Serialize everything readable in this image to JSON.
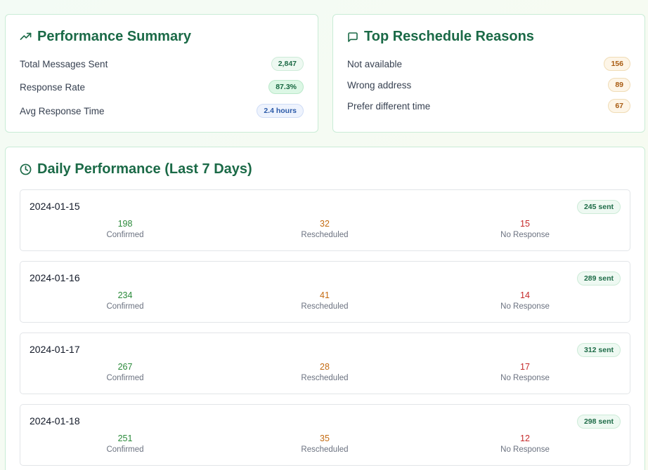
{
  "performance_summary": {
    "title": "Performance Summary",
    "icon": "trending-up-icon",
    "rows": [
      {
        "label": "Total Messages Sent",
        "value": "2,847"
      },
      {
        "label": "Response Rate",
        "value": "87.3%"
      },
      {
        "label": "Avg Response Time",
        "value": "2.4 hours"
      }
    ]
  },
  "reschedule_reasons": {
    "title": "Top Reschedule Reasons",
    "icon": "message-square-icon",
    "rows": [
      {
        "label": "Not available",
        "value": "156"
      },
      {
        "label": "Wrong address",
        "value": "89"
      },
      {
        "label": "Prefer different time",
        "value": "67"
      }
    ]
  },
  "daily_performance": {
    "title": "Daily Performance (Last 7 Days)",
    "icon": "clock-icon",
    "stat_labels": {
      "confirmed": "Confirmed",
      "rescheduled": "Rescheduled",
      "no_response": "No Response"
    },
    "days": [
      {
        "date": "2024-01-15",
        "sent": "245 sent",
        "confirmed": "198",
        "rescheduled": "32",
        "no_response": "15"
      },
      {
        "date": "2024-01-16",
        "sent": "289 sent",
        "confirmed": "234",
        "rescheduled": "41",
        "no_response": "14"
      },
      {
        "date": "2024-01-17",
        "sent": "312 sent",
        "confirmed": "267",
        "rescheduled": "28",
        "no_response": "17"
      },
      {
        "date": "2024-01-18",
        "sent": "298 sent",
        "confirmed": "251",
        "rescheduled": "35",
        "no_response": "12"
      }
    ]
  },
  "colors": {
    "accent": "#1b6a47",
    "confirmed": "#2a8a3a",
    "rescheduled": "#c46b12",
    "no_response": "#c62b2b"
  }
}
